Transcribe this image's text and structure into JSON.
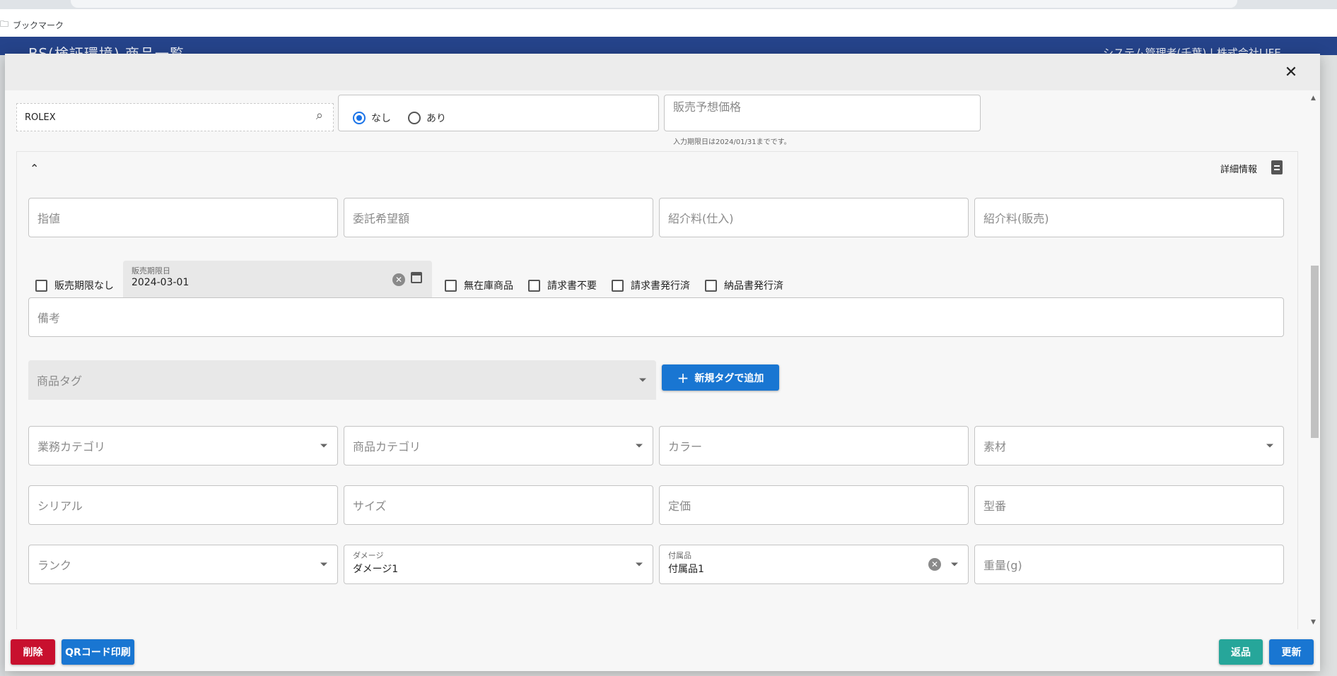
{
  "browser": {
    "bookmark_label": "ブックマーク"
  },
  "app_header": {
    "title": "BS(検証環境) 商品一覧",
    "user": "システム管理者(千葉) | 株式会社LIFE"
  },
  "top_row": {
    "brand_value": "ROLEX",
    "radio_options": [
      {
        "label": "なし",
        "selected": true
      },
      {
        "label": "あり",
        "selected": false
      }
    ],
    "price_placeholder": "販売予想価格",
    "hint": "入力期限日は2024/01/31までです。"
  },
  "detail": {
    "title": "詳細情報",
    "row1": [
      "指値",
      "委託希望額",
      "紹介料(仕入)",
      "紹介料(販売)"
    ],
    "no_limit_label": "販売期限なし",
    "sale_deadline": {
      "label": "販売期限日",
      "value": "2024-03-01"
    },
    "flags": [
      "無在庫商品",
      "請求書不要",
      "請求書発行済",
      "納品書発行済"
    ],
    "remarks_placeholder": "備考",
    "tag_placeholder": "商品タグ",
    "add_tag_button": "新規タグで追加",
    "row3": [
      "業務カテゴリ",
      "商品カテゴリ",
      "カラー",
      "素材"
    ],
    "row4": [
      "シリアル",
      "サイズ",
      "定価",
      "型番"
    ],
    "rank_placeholder": "ランク",
    "damage": {
      "label": "ダメージ",
      "value": "ダメージ1"
    },
    "accessory": {
      "label": "付属品",
      "value": "付属品1"
    },
    "weight_placeholder": "重量(g)"
  },
  "footer": {
    "delete_button": "削除",
    "qr_button": "QRコード印刷",
    "return_button": "返品",
    "update_button": "更新"
  },
  "colors": {
    "header": "#25438a",
    "primary": "#1976d2",
    "danger": "#c8102e",
    "teal": "#26a69a"
  }
}
